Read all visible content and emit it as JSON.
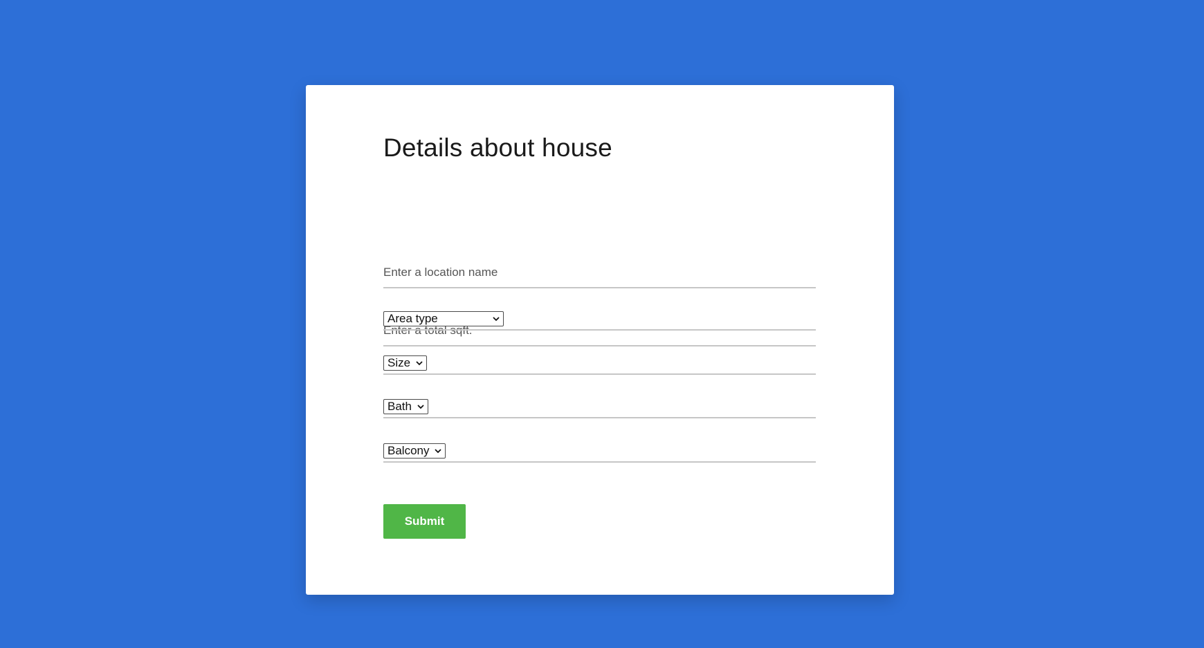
{
  "form": {
    "title": "Details about house",
    "location": {
      "placeholder": "Enter a location name",
      "value": ""
    },
    "sqft": {
      "placeholder": "Enter a total sqft.",
      "value": ""
    },
    "area_type": {
      "selected": "Area type"
    },
    "size": {
      "selected": "Size"
    },
    "bath": {
      "selected": "Bath"
    },
    "balcony": {
      "selected": "Balcony"
    },
    "submit_label": "Submit"
  },
  "colors": {
    "background": "#2d6fd7",
    "card": "#ffffff",
    "submit": "#50b647"
  },
  "icons": {
    "dropdown": "chevron-down-icon"
  }
}
